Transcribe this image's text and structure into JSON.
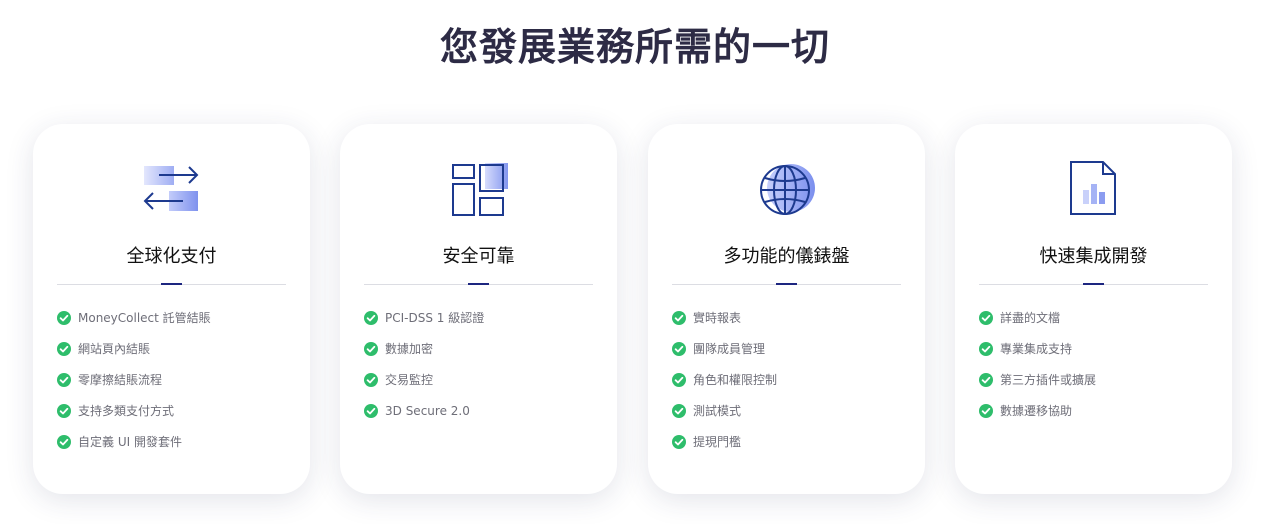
{
  "page": {
    "title": "您發展業務所需的一切"
  },
  "colors": {
    "title": "#2d2b45",
    "icon_stroke": "#1d3a8f",
    "icon_fill_light": "#c9d1fa",
    "icon_fill_mid": "#8b9cf0",
    "check_green": "#2ebd6b",
    "divider_accent": "#1d2680"
  },
  "cards": [
    {
      "icon": "exchange-arrows-icon",
      "title": "全球化支付",
      "features": [
        "MoneyCollect 託管結賬",
        "網站頁內結賬",
        "零摩擦結賬流程",
        "支持多類支付方式",
        "自定義 UI 開發套件"
      ]
    },
    {
      "icon": "layout-blocks-icon",
      "title": "安全可靠",
      "features": [
        "PCI-DSS 1 級認證",
        "數據加密",
        "交易監控",
        "3D Secure 2.0"
      ]
    },
    {
      "icon": "globe-icon",
      "title": "多功能的儀錶盤",
      "features": [
        "實時報表",
        "團隊成員管理",
        "角色和權限控制",
        "測試模式",
        "提現門檻"
      ]
    },
    {
      "icon": "document-chart-icon",
      "title": "快速集成開發",
      "features": [
        "詳盡的文檔",
        "專業集成支持",
        "第三方插件或擴展",
        "數據遷移協助"
      ]
    }
  ]
}
